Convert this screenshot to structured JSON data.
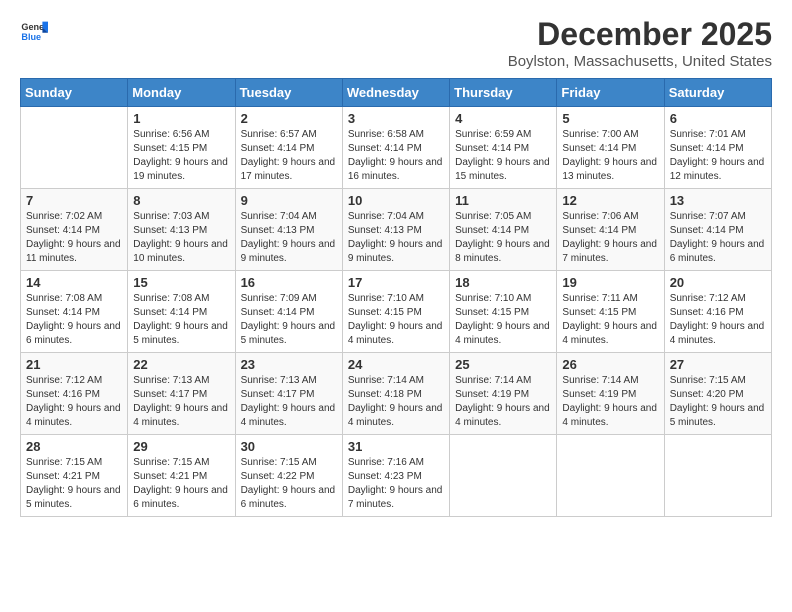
{
  "logo": {
    "general": "General",
    "blue": "Blue"
  },
  "header": {
    "month": "December 2025",
    "location": "Boylston, Massachusetts, United States"
  },
  "days_of_week": [
    "Sunday",
    "Monday",
    "Tuesday",
    "Wednesday",
    "Thursday",
    "Friday",
    "Saturday"
  ],
  "weeks": [
    [
      {
        "day": "",
        "sunrise": "",
        "sunset": "",
        "daylight": ""
      },
      {
        "day": "1",
        "sunrise": "Sunrise: 6:56 AM",
        "sunset": "Sunset: 4:15 PM",
        "daylight": "Daylight: 9 hours and 19 minutes."
      },
      {
        "day": "2",
        "sunrise": "Sunrise: 6:57 AM",
        "sunset": "Sunset: 4:14 PM",
        "daylight": "Daylight: 9 hours and 17 minutes."
      },
      {
        "day": "3",
        "sunrise": "Sunrise: 6:58 AM",
        "sunset": "Sunset: 4:14 PM",
        "daylight": "Daylight: 9 hours and 16 minutes."
      },
      {
        "day": "4",
        "sunrise": "Sunrise: 6:59 AM",
        "sunset": "Sunset: 4:14 PM",
        "daylight": "Daylight: 9 hours and 15 minutes."
      },
      {
        "day": "5",
        "sunrise": "Sunrise: 7:00 AM",
        "sunset": "Sunset: 4:14 PM",
        "daylight": "Daylight: 9 hours and 13 minutes."
      },
      {
        "day": "6",
        "sunrise": "Sunrise: 7:01 AM",
        "sunset": "Sunset: 4:14 PM",
        "daylight": "Daylight: 9 hours and 12 minutes."
      }
    ],
    [
      {
        "day": "7",
        "sunrise": "Sunrise: 7:02 AM",
        "sunset": "Sunset: 4:14 PM",
        "daylight": "Daylight: 9 hours and 11 minutes."
      },
      {
        "day": "8",
        "sunrise": "Sunrise: 7:03 AM",
        "sunset": "Sunset: 4:13 PM",
        "daylight": "Daylight: 9 hours and 10 minutes."
      },
      {
        "day": "9",
        "sunrise": "Sunrise: 7:04 AM",
        "sunset": "Sunset: 4:13 PM",
        "daylight": "Daylight: 9 hours and 9 minutes."
      },
      {
        "day": "10",
        "sunrise": "Sunrise: 7:04 AM",
        "sunset": "Sunset: 4:13 PM",
        "daylight": "Daylight: 9 hours and 9 minutes."
      },
      {
        "day": "11",
        "sunrise": "Sunrise: 7:05 AM",
        "sunset": "Sunset: 4:14 PM",
        "daylight": "Daylight: 9 hours and 8 minutes."
      },
      {
        "day": "12",
        "sunrise": "Sunrise: 7:06 AM",
        "sunset": "Sunset: 4:14 PM",
        "daylight": "Daylight: 9 hours and 7 minutes."
      },
      {
        "day": "13",
        "sunrise": "Sunrise: 7:07 AM",
        "sunset": "Sunset: 4:14 PM",
        "daylight": "Daylight: 9 hours and 6 minutes."
      }
    ],
    [
      {
        "day": "14",
        "sunrise": "Sunrise: 7:08 AM",
        "sunset": "Sunset: 4:14 PM",
        "daylight": "Daylight: 9 hours and 6 minutes."
      },
      {
        "day": "15",
        "sunrise": "Sunrise: 7:08 AM",
        "sunset": "Sunset: 4:14 PM",
        "daylight": "Daylight: 9 hours and 5 minutes."
      },
      {
        "day": "16",
        "sunrise": "Sunrise: 7:09 AM",
        "sunset": "Sunset: 4:14 PM",
        "daylight": "Daylight: 9 hours and 5 minutes."
      },
      {
        "day": "17",
        "sunrise": "Sunrise: 7:10 AM",
        "sunset": "Sunset: 4:15 PM",
        "daylight": "Daylight: 9 hours and 4 minutes."
      },
      {
        "day": "18",
        "sunrise": "Sunrise: 7:10 AM",
        "sunset": "Sunset: 4:15 PM",
        "daylight": "Daylight: 9 hours and 4 minutes."
      },
      {
        "day": "19",
        "sunrise": "Sunrise: 7:11 AM",
        "sunset": "Sunset: 4:15 PM",
        "daylight": "Daylight: 9 hours and 4 minutes."
      },
      {
        "day": "20",
        "sunrise": "Sunrise: 7:12 AM",
        "sunset": "Sunset: 4:16 PM",
        "daylight": "Daylight: 9 hours and 4 minutes."
      }
    ],
    [
      {
        "day": "21",
        "sunrise": "Sunrise: 7:12 AM",
        "sunset": "Sunset: 4:16 PM",
        "daylight": "Daylight: 9 hours and 4 minutes."
      },
      {
        "day": "22",
        "sunrise": "Sunrise: 7:13 AM",
        "sunset": "Sunset: 4:17 PM",
        "daylight": "Daylight: 9 hours and 4 minutes."
      },
      {
        "day": "23",
        "sunrise": "Sunrise: 7:13 AM",
        "sunset": "Sunset: 4:17 PM",
        "daylight": "Daylight: 9 hours and 4 minutes."
      },
      {
        "day": "24",
        "sunrise": "Sunrise: 7:14 AM",
        "sunset": "Sunset: 4:18 PM",
        "daylight": "Daylight: 9 hours and 4 minutes."
      },
      {
        "day": "25",
        "sunrise": "Sunrise: 7:14 AM",
        "sunset": "Sunset: 4:19 PM",
        "daylight": "Daylight: 9 hours and 4 minutes."
      },
      {
        "day": "26",
        "sunrise": "Sunrise: 7:14 AM",
        "sunset": "Sunset: 4:19 PM",
        "daylight": "Daylight: 9 hours and 4 minutes."
      },
      {
        "day": "27",
        "sunrise": "Sunrise: 7:15 AM",
        "sunset": "Sunset: 4:20 PM",
        "daylight": "Daylight: 9 hours and 5 minutes."
      }
    ],
    [
      {
        "day": "28",
        "sunrise": "Sunrise: 7:15 AM",
        "sunset": "Sunset: 4:21 PM",
        "daylight": "Daylight: 9 hours and 5 minutes."
      },
      {
        "day": "29",
        "sunrise": "Sunrise: 7:15 AM",
        "sunset": "Sunset: 4:21 PM",
        "daylight": "Daylight: 9 hours and 6 minutes."
      },
      {
        "day": "30",
        "sunrise": "Sunrise: 7:15 AM",
        "sunset": "Sunset: 4:22 PM",
        "daylight": "Daylight: 9 hours and 6 minutes."
      },
      {
        "day": "31",
        "sunrise": "Sunrise: 7:16 AM",
        "sunset": "Sunset: 4:23 PM",
        "daylight": "Daylight: 9 hours and 7 minutes."
      },
      {
        "day": "",
        "sunrise": "",
        "sunset": "",
        "daylight": ""
      },
      {
        "day": "",
        "sunrise": "",
        "sunset": "",
        "daylight": ""
      },
      {
        "day": "",
        "sunrise": "",
        "sunset": "",
        "daylight": ""
      }
    ]
  ]
}
